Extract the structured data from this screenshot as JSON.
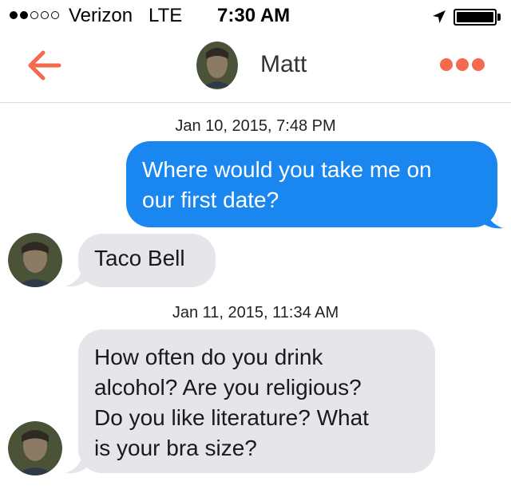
{
  "status_bar": {
    "carrier": "Verizon",
    "network": "LTE",
    "time": "7:30 AM",
    "signal_bars_filled": 2,
    "signal_bars_total": 5,
    "battery_level": 1.0
  },
  "header": {
    "contact_name": "Matt",
    "back_icon": "arrow-left",
    "more_icon": "three-dots",
    "accent_color": "#f5694e"
  },
  "conversation": {
    "messages": [
      {
        "timestamp": "Jan 10, 2015, 7:48 PM"
      },
      {
        "direction": "outgoing",
        "lines": [
          "Where would you take me on",
          "our first date?"
        ]
      },
      {
        "direction": "incoming",
        "lines": [
          "Taco Bell"
        ]
      },
      {
        "timestamp": "Jan 11, 2015, 11:34 AM"
      },
      {
        "direction": "incoming",
        "lines": [
          "How often do you drink",
          "alcohol?  Are you religious?",
          "Do you like literature?  What",
          "is your bra size?"
        ]
      }
    ]
  },
  "colors": {
    "outgoing_bubble": "#1a86f0",
    "incoming_bubble": "#e5e5ea",
    "accent": "#f5694e"
  }
}
